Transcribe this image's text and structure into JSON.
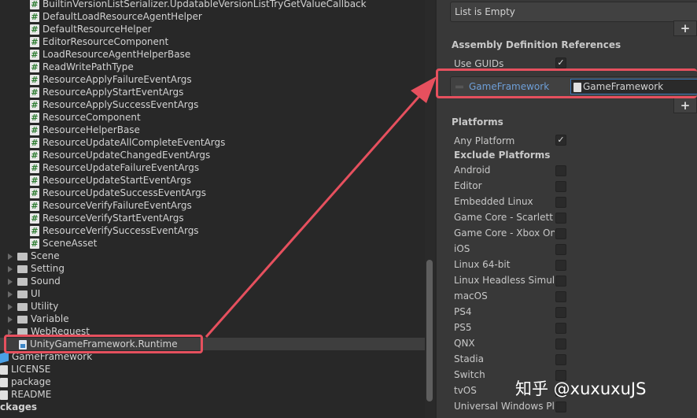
{
  "tree": {
    "scripts": [
      "BuiltinVersionListSerializer.UpdatableVersionListTryGetValueCallback",
      "DefaultLoadResourceAgentHelper",
      "DefaultResourceHelper",
      "EditorResourceComponent",
      "LoadResourceAgentHelperBase",
      "ReadWritePathType",
      "ResourceApplyFailureEventArgs",
      "ResourceApplyStartEventArgs",
      "ResourceApplySuccessEventArgs",
      "ResourceComponent",
      "ResourceHelperBase",
      "ResourceUpdateAllCompleteEventArgs",
      "ResourceUpdateChangedEventArgs",
      "ResourceUpdateFailureEventArgs",
      "ResourceUpdateStartEventArgs",
      "ResourceUpdateSuccessEventArgs",
      "ResourceVerifyFailureEventArgs",
      "ResourceVerifyStartEventArgs",
      "ResourceVerifySuccessEventArgs",
      "SceneAsset"
    ],
    "folders": [
      "Scene",
      "Setting",
      "Sound",
      "UI",
      "Utility",
      "Variable",
      "WebRequest"
    ],
    "selected": "UnityGameFramework.Runtime",
    "root_items": [
      {
        "label": "GameFramework",
        "icon": "package-icon"
      },
      {
        "label": "LICENSE",
        "icon": "document-icon"
      },
      {
        "label": "package",
        "icon": "document-icon"
      },
      {
        "label": "README",
        "icon": "document-icon"
      }
    ],
    "packages": "ckages"
  },
  "inspector": {
    "list_empty": "List is Empty",
    "plus": "+",
    "asm_refs_title": "Assembly Definition References",
    "use_guids": "Use GUIDs",
    "check": "✓",
    "ref_name": "GameFramework",
    "ref_value": "GameFramework",
    "platforms_title": "Platforms",
    "any_platform": "Any Platform",
    "exclude_title": "Exclude Platforms",
    "platforms": [
      "Android",
      "Editor",
      "Embedded Linux",
      "Game Core - Scarlett",
      "Game Core - Xbox One",
      "iOS",
      "Linux 64-bit",
      "Linux Headless Simulation",
      "macOS",
      "PS4",
      "PS5",
      "QNX",
      "Stadia",
      "Switch",
      "tvOS",
      "Universal Windows Platform"
    ]
  },
  "colors": {
    "highlight": "#e6505e"
  },
  "watermark": "知乎 @xuxuxuJS"
}
